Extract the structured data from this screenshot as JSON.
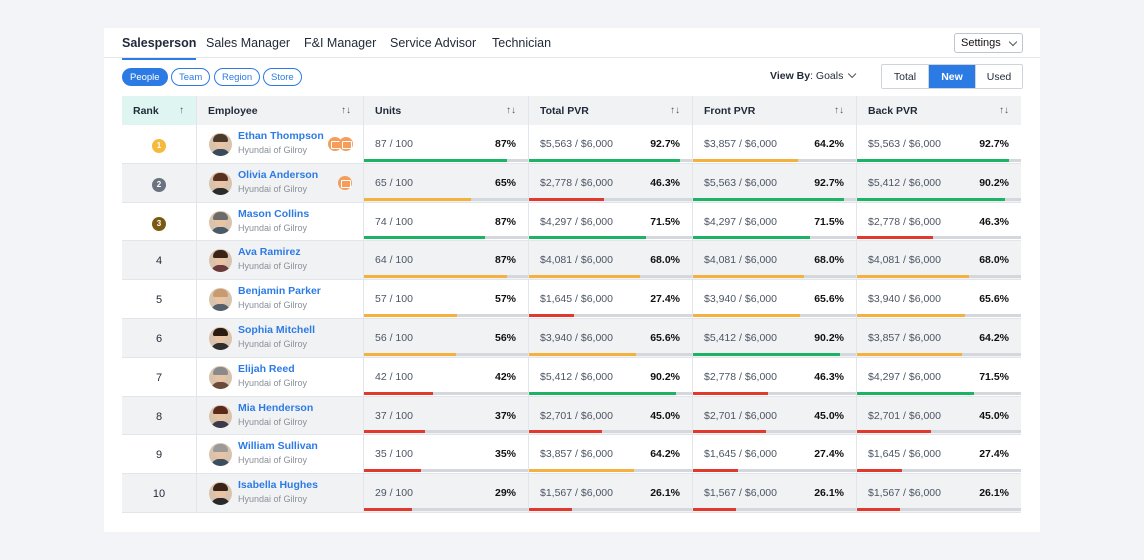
{
  "tabs": [
    "Salesperson",
    "Sales Manager",
    "F&I Manager",
    "Service Advisor",
    "Technician"
  ],
  "active_tab": 0,
  "settings_label": "Settings",
  "chips": [
    "People",
    "Team",
    "Region",
    "Store"
  ],
  "view_by": {
    "label": "View By",
    "value": ": Goals"
  },
  "segment": [
    "Total",
    "New",
    "Used"
  ],
  "headers": {
    "rank": "Rank",
    "employee": "Employee",
    "units": "Units",
    "total": "Total PVR",
    "front": "Front PVR",
    "back": "Back PVR"
  },
  "sort_icon": "↑↓",
  "rank_sort_icon": "↑",
  "colors": {
    "accent": "#2c7be5",
    "green": "#1db364",
    "orange": "#f5b13d",
    "red": "#e03a2f"
  },
  "rows": [
    {
      "rank": "1",
      "name": "Ethan Thompson",
      "store": "Hyundai of Gilroy",
      "badges": 2,
      "units": "87 / 100",
      "units_pct": "87%",
      "units_fill": 0.87,
      "units_color": "green",
      "total": "$5,563 / $6,000",
      "total_pct": "92.7%",
      "total_fill": 0.927,
      "total_color": "green",
      "front": "$3,857 / $6,000",
      "front_pct": "64.2%",
      "front_fill": 0.642,
      "front_color": "orange",
      "back": "$5,563 / $6,000",
      "back_pct": "92.7%",
      "back_fill": 0.927,
      "back_color": "green"
    },
    {
      "rank": "2",
      "name": "Olivia Anderson",
      "store": "Hyundai of Gilroy",
      "badges": 1,
      "units": "65 / 100",
      "units_pct": "65%",
      "units_fill": 0.65,
      "units_color": "orange",
      "total": "$2,778 / $6,000",
      "total_pct": "46.3%",
      "total_fill": 0.463,
      "total_color": "red",
      "front": "$5,563 / $6,000",
      "front_pct": "92.7%",
      "front_fill": 0.927,
      "front_color": "green",
      "back": "$5,412 / $6,000",
      "back_pct": "90.2%",
      "back_fill": 0.902,
      "back_color": "green"
    },
    {
      "rank": "3",
      "name": "Mason Collins",
      "store": "Hyundai of Gilroy",
      "badges": 0,
      "units": "74 / 100",
      "units_pct": "87%",
      "units_fill": 0.74,
      "units_color": "green",
      "total": "$4,297 / $6,000",
      "total_pct": "71.5%",
      "total_fill": 0.715,
      "total_color": "green",
      "front": "$4,297 / $6,000",
      "front_pct": "71.5%",
      "front_fill": 0.715,
      "front_color": "green",
      "back": "$2,778 / $6,000",
      "back_pct": "46.3%",
      "back_fill": 0.463,
      "back_color": "red"
    },
    {
      "rank": "4",
      "name": "Ava Ramirez",
      "store": "Hyundai of Gilroy",
      "badges": 0,
      "units": "64 / 100",
      "units_pct": "87%",
      "units_fill": 0.87,
      "units_color": "orange",
      "total": "$4,081 / $6,000",
      "total_pct": "68.0%",
      "total_fill": 0.68,
      "total_color": "orange",
      "front": "$4,081 / $6,000",
      "front_pct": "68.0%",
      "front_fill": 0.68,
      "front_color": "orange",
      "back": "$4,081 / $6,000",
      "back_pct": "68.0%",
      "back_fill": 0.68,
      "back_color": "orange"
    },
    {
      "rank": "5",
      "name": "Benjamin Parker",
      "store": "Hyundai of Gilroy",
      "badges": 0,
      "units": "57 / 100",
      "units_pct": "57%",
      "units_fill": 0.57,
      "units_color": "orange",
      "total": "$1,645 / $6,000",
      "total_pct": "27.4%",
      "total_fill": 0.274,
      "total_color": "red",
      "front": "$3,940 / $6,000",
      "front_pct": "65.6%",
      "front_fill": 0.656,
      "front_color": "orange",
      "back": "$3,940 / $6,000",
      "back_pct": "65.6%",
      "back_fill": 0.656,
      "back_color": "orange"
    },
    {
      "rank": "6",
      "name": "Sophia Mitchell",
      "store": "Hyundai of Gilroy",
      "badges": 0,
      "units": "56 / 100",
      "units_pct": "56%",
      "units_fill": 0.56,
      "units_color": "orange",
      "total": "$3,940 / $6,000",
      "total_pct": "65.6%",
      "total_fill": 0.656,
      "total_color": "orange",
      "front": "$5,412 / $6,000",
      "front_pct": "90.2%",
      "front_fill": 0.902,
      "front_color": "green",
      "back": "$3,857 / $6,000",
      "back_pct": "64.2%",
      "back_fill": 0.642,
      "back_color": "orange"
    },
    {
      "rank": "7",
      "name": "Elijah Reed",
      "store": "Hyundai of Gilroy",
      "badges": 0,
      "units": "42 / 100",
      "units_pct": "42%",
      "units_fill": 0.42,
      "units_color": "red",
      "total": "$5,412 / $6,000",
      "total_pct": "90.2%",
      "total_fill": 0.902,
      "total_color": "green",
      "front": "$2,778 / $6,000",
      "front_pct": "46.3%",
      "front_fill": 0.463,
      "front_color": "red",
      "back": "$4,297 / $6,000",
      "back_pct": "71.5%",
      "back_fill": 0.715,
      "back_color": "green"
    },
    {
      "rank": "8",
      "name": "Mia Henderson",
      "store": "Hyundai of Gilroy",
      "badges": 0,
      "units": "37 / 100",
      "units_pct": "37%",
      "units_fill": 0.37,
      "units_color": "red",
      "total": "$2,701 / $6,000",
      "total_pct": "45.0%",
      "total_fill": 0.45,
      "total_color": "red",
      "front": "$2,701 / $6,000",
      "front_pct": "45.0%",
      "front_fill": 0.45,
      "front_color": "red",
      "back": "$2,701 / $6,000",
      "back_pct": "45.0%",
      "back_fill": 0.45,
      "back_color": "red"
    },
    {
      "rank": "9",
      "name": "William Sullivan",
      "store": "Hyundai of Gilroy",
      "badges": 0,
      "units": "35 / 100",
      "units_pct": "35%",
      "units_fill": 0.35,
      "units_color": "red",
      "total": "$3,857 / $6,000",
      "total_pct": "64.2%",
      "total_fill": 0.642,
      "total_color": "orange",
      "front": "$1,645 / $6,000",
      "front_pct": "27.4%",
      "front_fill": 0.274,
      "front_color": "red",
      "back": "$1,645 / $6,000",
      "back_pct": "27.4%",
      "back_fill": 0.274,
      "back_color": "red"
    },
    {
      "rank": "10",
      "name": "Isabella Hughes",
      "store": "Hyundai of Gilroy",
      "badges": 0,
      "units": "29 / 100",
      "units_pct": "29%",
      "units_fill": 0.29,
      "units_color": "red",
      "total": "$1,567 / $6,000",
      "total_pct": "26.1%",
      "total_fill": 0.261,
      "total_color": "red",
      "front": "$1,567 / $6,000",
      "front_pct": "26.1%",
      "front_fill": 0.261,
      "front_color": "red",
      "back": "$1,567 / $6,000",
      "back_pct": "26.1%",
      "back_fill": 0.261,
      "back_color": "red"
    }
  ]
}
